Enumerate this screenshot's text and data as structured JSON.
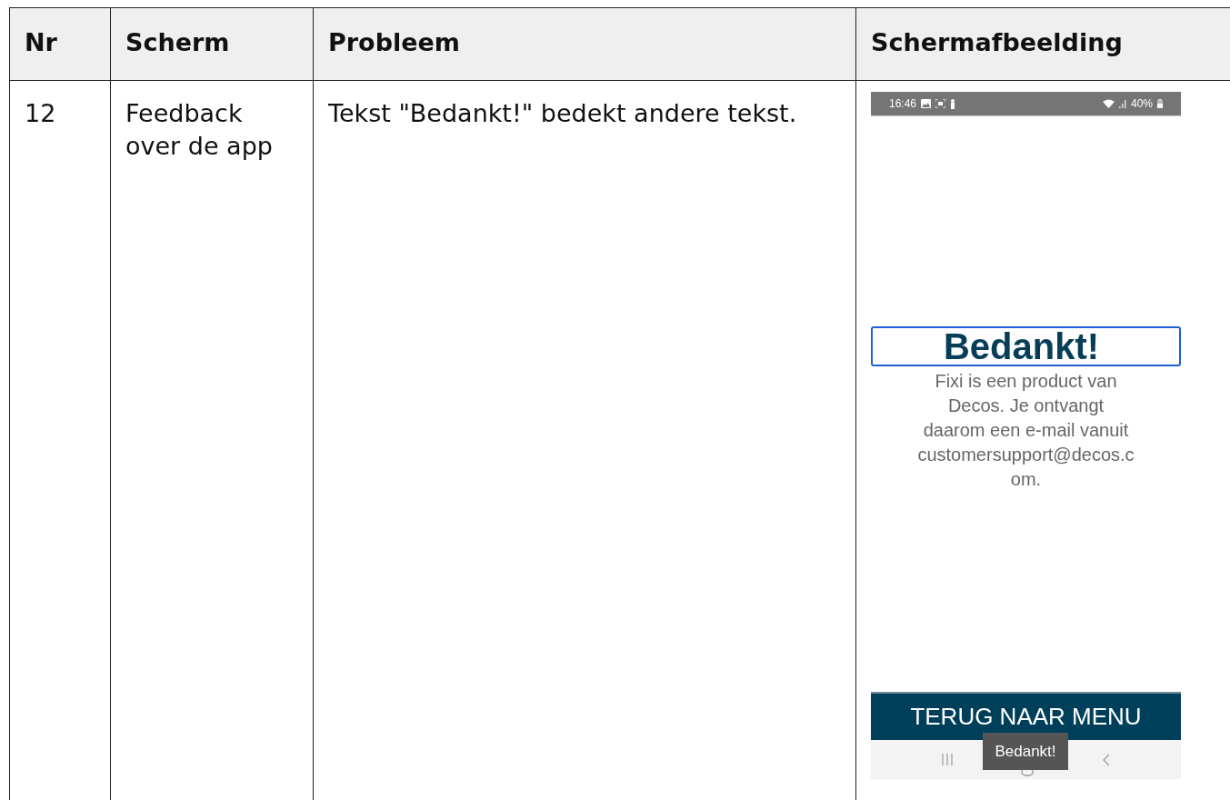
{
  "table": {
    "columns": [
      "Nr",
      "Scherm",
      "Probleem",
      "Schermafbeelding"
    ],
    "rows": [
      {
        "nr": "12",
        "scherm": "Feedback over de app",
        "probleem": "Tekst \"Bedankt!\" bedekt andere tekst.",
        "screenshot": {
          "status_bar": {
            "time": "16:46",
            "battery": "40%"
          },
          "title": "Bedankt!",
          "body_lines": [
            "Fixi is een product van",
            "Decos. Je ontvangt",
            "daarom een e-mail vanuit",
            "customersupport@decos.c",
            "om."
          ],
          "button": "TERUG NAAR MENU",
          "toast": "Bedankt!"
        }
      }
    ]
  }
}
